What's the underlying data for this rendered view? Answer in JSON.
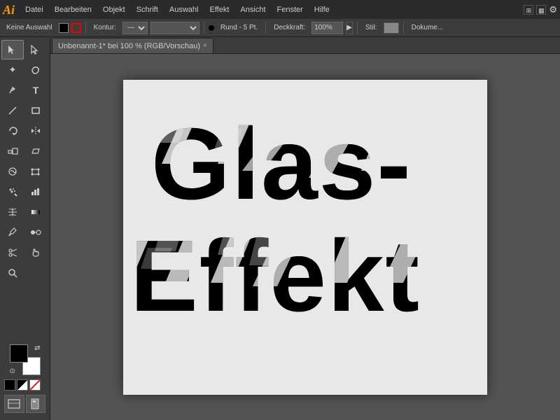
{
  "app": {
    "logo": "Ai",
    "title": "Adobe Illustrator"
  },
  "menubar": {
    "items": [
      "Datei",
      "Bearbeiten",
      "Objekt",
      "Schrift",
      "Auswahl",
      "Effekt",
      "Ansicht",
      "Fenster",
      "Hilfe"
    ]
  },
  "toolbar": {
    "selection_label": "Keine Auswahl",
    "kontur_label": "Kontur:",
    "brush_type": "Rund - 5 Pt.",
    "opacity_label": "Deckkraft:",
    "opacity_value": "100%",
    "stil_label": "Stil:",
    "dokument_label": "Dokume..."
  },
  "tab": {
    "title": "Unbenannt-1* bei 100 % (RGB/Vorschau)",
    "close": "×"
  },
  "canvas": {
    "text_line1": "Glas-",
    "text_line2": "Effekt"
  },
  "tools": [
    {
      "name": "selection",
      "icon": "↖",
      "title": "Auswahl"
    },
    {
      "name": "direct-selection",
      "icon": "↗",
      "title": "Direktauswahl"
    },
    {
      "name": "magic-wand",
      "icon": "✦",
      "title": "Zauberstab"
    },
    {
      "name": "lasso",
      "icon": "⌇",
      "title": "Lasso"
    },
    {
      "name": "pen",
      "icon": "✒",
      "title": "Zeichenstift"
    },
    {
      "name": "type",
      "icon": "T",
      "title": "Text"
    },
    {
      "name": "line",
      "icon": "╲",
      "title": "Linie"
    },
    {
      "name": "rectangle",
      "icon": "□",
      "title": "Rechteck"
    },
    {
      "name": "rotate",
      "icon": "↻",
      "title": "Drehen"
    },
    {
      "name": "reflect",
      "icon": "⇔",
      "title": "Spiegeln"
    },
    {
      "name": "scale",
      "icon": "⤡",
      "title": "Skalieren"
    },
    {
      "name": "shear",
      "icon": "⌻",
      "title": "Verbiegen"
    },
    {
      "name": "warp",
      "icon": "⌖",
      "title": "Verkrümmung"
    },
    {
      "name": "free-transform",
      "icon": "⊡",
      "title": "Frei transformieren"
    },
    {
      "name": "symbol-spray",
      "icon": "⊕",
      "title": "Symbolsprüher"
    },
    {
      "name": "column-chart",
      "icon": "▦",
      "title": "Diagramm"
    },
    {
      "name": "mesh",
      "icon": "⌘",
      "title": "Gitter"
    },
    {
      "name": "gradient",
      "icon": "▣",
      "title": "Verlauf"
    },
    {
      "name": "eyedropper",
      "icon": "⊸",
      "title": "Pipette"
    },
    {
      "name": "blend",
      "icon": "∞",
      "title": "Angleichen"
    },
    {
      "name": "scissors",
      "icon": "✂",
      "title": "Schere"
    },
    {
      "name": "hand",
      "icon": "✋",
      "title": "Hand"
    },
    {
      "name": "zoom",
      "icon": "🔍",
      "title": "Zoom"
    }
  ]
}
